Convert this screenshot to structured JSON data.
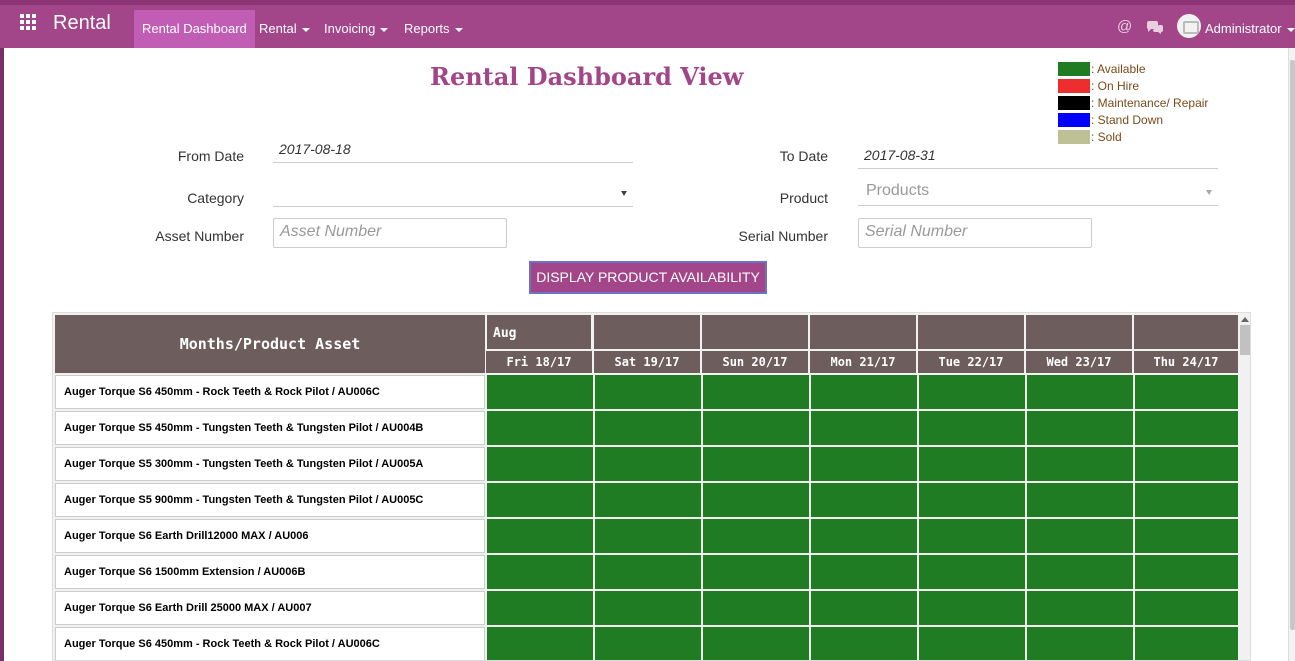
{
  "app": {
    "brand": "Rental"
  },
  "nav": [
    {
      "label": "Rental Dashboard",
      "active": true,
      "dropdown": false
    },
    {
      "label": "Rental",
      "active": false,
      "dropdown": true
    },
    {
      "label": "Invoicing",
      "active": false,
      "dropdown": true
    },
    {
      "label": "Reports",
      "active": false,
      "dropdown": true
    }
  ],
  "user": {
    "name": "Administrator",
    "icons": [
      "at-icon",
      "chat-icon"
    ]
  },
  "page": {
    "title": "Rental Dashboard View"
  },
  "legend": [
    {
      "label": ": Available",
      "color": "#207c22"
    },
    {
      "label": ": On Hire",
      "color": "#ee2e2e"
    },
    {
      "label": ": Maintenance/ Repair",
      "color": "#000000"
    },
    {
      "label": ": Stand Down",
      "color": "#0000ff"
    },
    {
      "label": ": Sold",
      "color": "#bdc195"
    }
  ],
  "filters": {
    "from_date_label": "From Date",
    "from_date_value": "2017-08-18",
    "to_date_label": "To Date",
    "to_date_value": "2017-08-31",
    "category_label": "Category",
    "category_value": "",
    "product_label": "Product",
    "product_placeholder": "Products",
    "asset_label": "Asset Number",
    "asset_placeholder": "Asset Number",
    "serial_label": "Serial Number",
    "serial_placeholder": "Serial Number",
    "button_label": "DISPLAY PRODUCT AVAILABILITY"
  },
  "grid": {
    "corner_label": "Months/Product Asset",
    "month_label": "Aug",
    "days": [
      "Fri 18/17",
      "Sat 19/17",
      "Sun 20/17",
      "Mon 21/17",
      "Tue 22/17",
      "Wed 23/17",
      "Thu 24/17"
    ],
    "available_color": "#207c22",
    "rows": [
      {
        "label": "Auger Torque S6 450mm - Rock Teeth & Rock Pilot / AU006C"
      },
      {
        "label": "Auger Torque S5 450mm - Tungsten Teeth & Tungsten Pilot / AU004B"
      },
      {
        "label": "Auger Torque S5 300mm - Tungsten Teeth & Tungsten Pilot / AU005A"
      },
      {
        "label": "Auger Torque S5 900mm - Tungsten Teeth & Tungsten Pilot / AU005C"
      },
      {
        "label": "Auger Torque S6 Earth Drill12000 MAX / AU006"
      },
      {
        "label": "Auger Torque S6 1500mm Extension / AU006B"
      },
      {
        "label": "Auger Torque S6 Earth Drill 25000 MAX / AU007"
      },
      {
        "label": "Auger Torque S6 450mm - Rock Teeth & Rock Pilot / AU006C"
      }
    ]
  }
}
